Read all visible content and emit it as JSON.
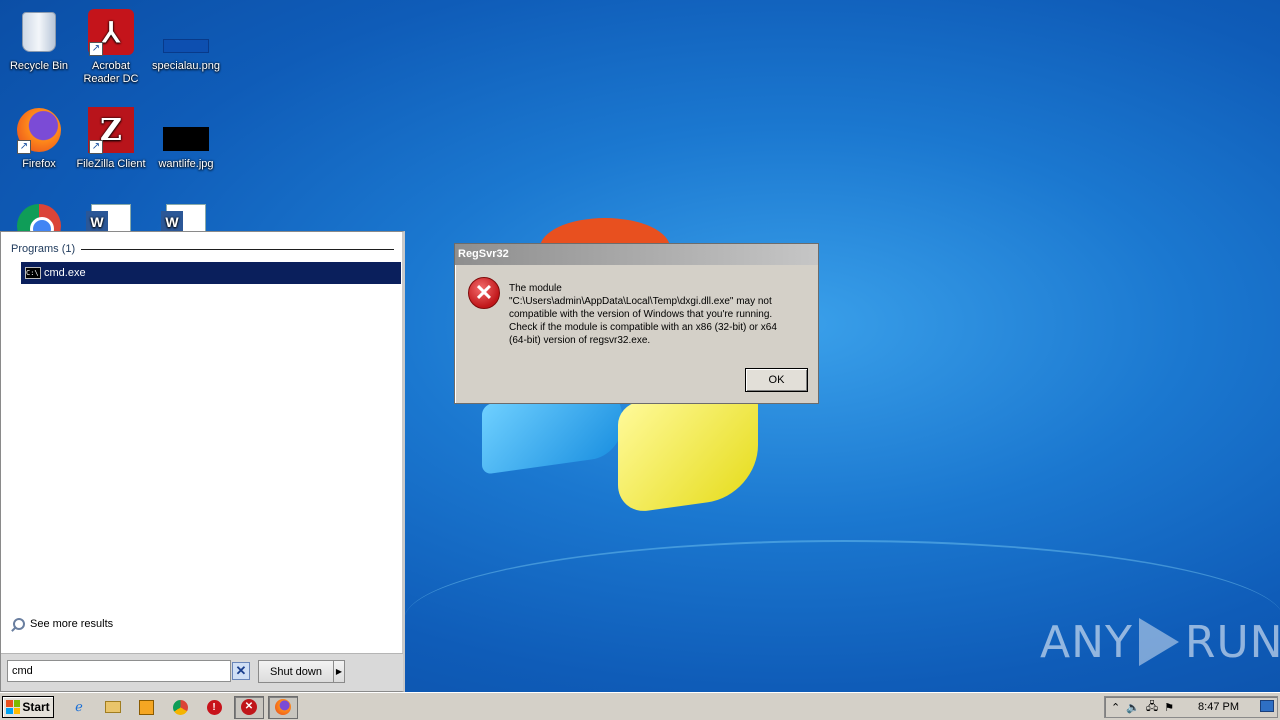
{
  "desktop": {
    "icons": [
      {
        "label": "Recycle Bin",
        "icon": "recycle-bin-icon"
      },
      {
        "label": "Acrobat\nReader DC",
        "icon": "acrobat-icon"
      },
      {
        "label": "specialau.png",
        "icon": "png-file-icon"
      },
      {
        "label": "Firefox",
        "icon": "firefox-icon"
      },
      {
        "label": "FileZilla Client",
        "icon": "filezilla-icon"
      },
      {
        "label": "wantlife.jpg",
        "icon": "jpg-file-icon"
      },
      {
        "label": "",
        "icon": "chrome-icon"
      },
      {
        "label": "",
        "icon": "word-icon"
      },
      {
        "label": "",
        "icon": "word-icon"
      }
    ],
    "watermark": {
      "left": "ANY",
      "right": "RUN"
    }
  },
  "start_menu": {
    "section_title": "Programs (1)",
    "result": "cmd.exe",
    "see_more": "See more results",
    "search_value": "cmd",
    "clear_glyph": "✕",
    "shutdown_label": "Shut down",
    "shutdown_arrow": "▶"
  },
  "dialog": {
    "title": "RegSvr32",
    "error_glyph": "✕",
    "message_lines": [
      "The module",
      "\"C:\\Users\\admin\\AppData\\Local\\Temp\\dxgi.dll.exe\" may not",
      "compatible with the version of Windows that you're running.",
      "Check if the module is compatible with an x86 (32-bit) or x64",
      "(64-bit) version of regsvr32.exe."
    ],
    "ok_label": "OK"
  },
  "taskbar": {
    "start_label": "Start",
    "clock": "8:47 PM",
    "tray_glyphs": [
      "⌃",
      "🔈",
      "🖧",
      "⚑"
    ]
  },
  "colors": {
    "selection": "#0a1f5c",
    "dialog_bg": "#d4d0c8",
    "error_red": "#c0161a"
  }
}
